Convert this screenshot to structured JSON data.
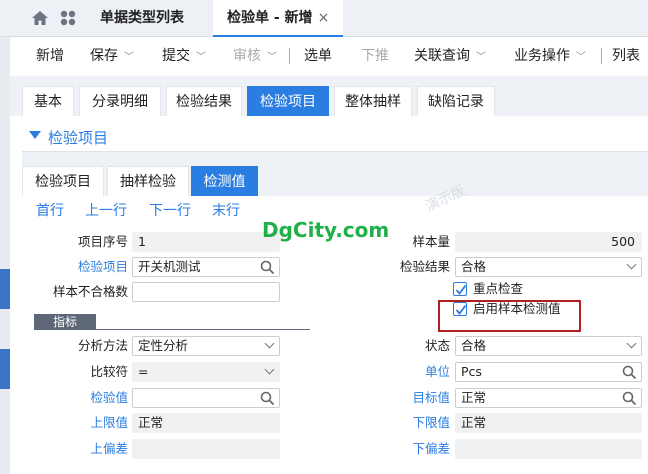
{
  "topbar": {
    "tabs": [
      {
        "label": "单据类型列表",
        "active": false
      },
      {
        "label": "检验单 - 新增",
        "active": true,
        "close": "×"
      }
    ]
  },
  "toolbar": {
    "items": [
      {
        "label": "新增",
        "arrow": false,
        "disabled": false
      },
      {
        "label": "保存",
        "arrow": true,
        "disabled": false
      },
      {
        "label": "提交",
        "arrow": true,
        "disabled": false
      },
      {
        "label": "审核",
        "arrow": true,
        "disabled": true
      },
      {
        "label": "选单",
        "arrow": false,
        "disabled": false
      },
      {
        "label": "下推",
        "arrow": false,
        "disabled": true
      },
      {
        "label": "关联查询",
        "arrow": true,
        "disabled": false
      },
      {
        "label": "业务操作",
        "arrow": true,
        "disabled": false
      },
      {
        "label": "列表",
        "arrow": false,
        "disabled": false
      }
    ]
  },
  "form_tabs": [
    {
      "label": "基本"
    },
    {
      "label": "分录明细"
    },
    {
      "label": "检验结果"
    },
    {
      "label": "检验项目",
      "active": true
    },
    {
      "label": "整体抽样"
    },
    {
      "label": "缺陷记录"
    }
  ],
  "section": {
    "title": "检验项目"
  },
  "sub_tabs": [
    {
      "label": "检验项目"
    },
    {
      "label": "抽样检验"
    },
    {
      "label": "检测值",
      "active": true
    }
  ],
  "nav_links": [
    "首行",
    "上一行",
    "下一行",
    "末行"
  ],
  "watermark": "DgCity.com",
  "faint_text": [
    "演示版"
  ],
  "form": {
    "item_seq": {
      "label": "项目序号",
      "value": "1"
    },
    "inspect_item": {
      "label": "检验项目",
      "value": "开关机测试"
    },
    "bad_count": {
      "label": "样本不合格数",
      "value": ""
    },
    "sample_qty": {
      "label": "样本量",
      "value": "500"
    },
    "inspect_result": {
      "label": "检验结果",
      "value": "合格"
    },
    "key_check": {
      "label": "重点检查",
      "checked": true
    },
    "enable_sample_value": {
      "label": "启用样本检测值",
      "checked": true
    },
    "indicator_header": "指标",
    "analysis_method": {
      "label": "分析方法",
      "value": "定性分析"
    },
    "comparator": {
      "label": "比较符",
      "value": "="
    },
    "inspect_value": {
      "label": "检验值",
      "value": ""
    },
    "upper_limit": {
      "label": "上限值",
      "value": "正常"
    },
    "upper_dev": {
      "label": "上偏差",
      "value": ""
    },
    "status": {
      "label": "状态",
      "value": "合格"
    },
    "unit": {
      "label": "单位",
      "value": "Pcs"
    },
    "target_value": {
      "label": "目标值",
      "value": "正常"
    },
    "lower_limit": {
      "label": "下限值",
      "value": "正常"
    },
    "lower_dev": {
      "label": "下偏差",
      "value": ""
    }
  },
  "colors": {
    "accent": "#2a7de1",
    "highlight_box": "#b02020",
    "watermark": "#1fb04a"
  }
}
